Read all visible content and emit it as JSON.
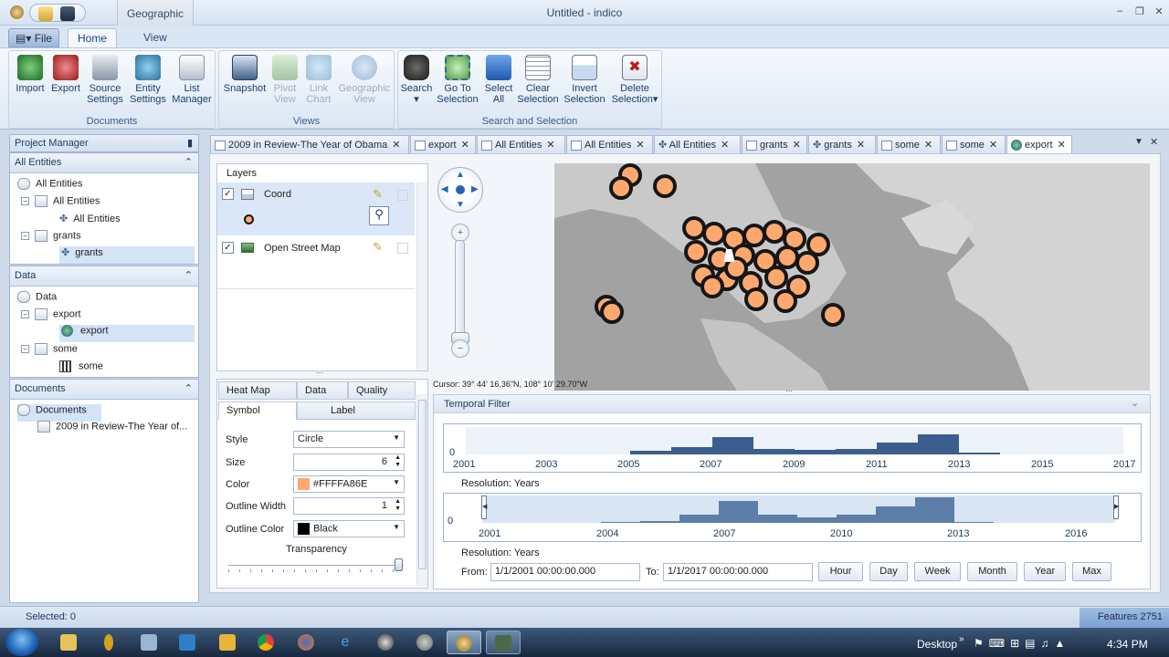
{
  "window": {
    "title": "Untitled - indico",
    "context_tab": "Geographic"
  },
  "ribbon_tabs": {
    "file": "File",
    "home": "Home",
    "view": "View"
  },
  "groups": {
    "documents": {
      "label": "Documents",
      "buttons": [
        "Import",
        "Export",
        "Source Settings",
        "Entity Settings",
        "List Manager"
      ]
    },
    "views": {
      "label": "Views",
      "buttons": [
        "Snapshot",
        "Pivot View",
        "Link Chart",
        "Geographic View"
      ]
    },
    "search": {
      "label": "Search and Selection",
      "buttons": [
        "Search",
        "Go To Selection",
        "Select All",
        "Clear Selection",
        "Invert Selection",
        "Delete Selection"
      ]
    }
  },
  "project_manager": {
    "title": "Project Manager",
    "all_entities": {
      "header": "All Entities",
      "items": [
        "All Entities",
        "All Entities",
        "All Entities",
        "grants",
        "grants"
      ]
    },
    "data": {
      "header": "Data",
      "items": [
        "Data",
        "export",
        "export",
        "some",
        "some"
      ]
    },
    "documents": {
      "header": "Documents",
      "items": [
        "Documents",
        "2009 in Review-The Year of..."
      ]
    }
  },
  "doc_tabs": [
    "2009 in Review-The Year of Obama",
    "export",
    "All Entities",
    "All Entities",
    "All Entities",
    "grants",
    "grants",
    "some",
    "some",
    "export"
  ],
  "layers": {
    "title": "Layers",
    "items": [
      "Coord",
      "Open Street Map"
    ]
  },
  "symbol_panel": {
    "tabs_top": [
      "Heat Map",
      "Data",
      "Quality"
    ],
    "tabs_bottom": [
      "Symbol",
      "Label"
    ],
    "style_label": "Style",
    "style_value": "Circle",
    "size_label": "Size",
    "size_value": "6",
    "color_label": "Color",
    "color_value": "#FFFFA86E",
    "color_swatch": "#ffa86e",
    "outline_width_label": "Outline Width",
    "outline_width_value": "1",
    "outline_color_label": "Outline Color",
    "outline_color_value": "Black",
    "transparency_label": "Transparency"
  },
  "map": {
    "cursor": "Cursor: 39° 44' 16.36\"N, 108° 10' 29.70\"W"
  },
  "temporal_filter": {
    "title": "Temporal Filter",
    "chart1_xticks": [
      "2001",
      "2003",
      "2005",
      "2007",
      "2009",
      "2011",
      "2013",
      "2015",
      "2017"
    ],
    "chart2_xticks": [
      "2001",
      "2004",
      "2007",
      "2010",
      "2013",
      "2016"
    ],
    "y_label": "0",
    "resolution1": "Resolution: Years",
    "resolution2": "Resolution: Years",
    "from_label": "From:",
    "from_value": "1/1/2001 00:00:00.000",
    "to_label": "To:",
    "to_value": "1/1/2017 00:00:00.000",
    "buttons": [
      "Hour",
      "Day",
      "Week",
      "Month",
      "Year",
      "Max"
    ]
  },
  "status": {
    "selected": "Selected: 0",
    "features": "Features 2751"
  },
  "taskbar": {
    "desktop": "Desktop",
    "clock": "4:34 PM"
  }
}
